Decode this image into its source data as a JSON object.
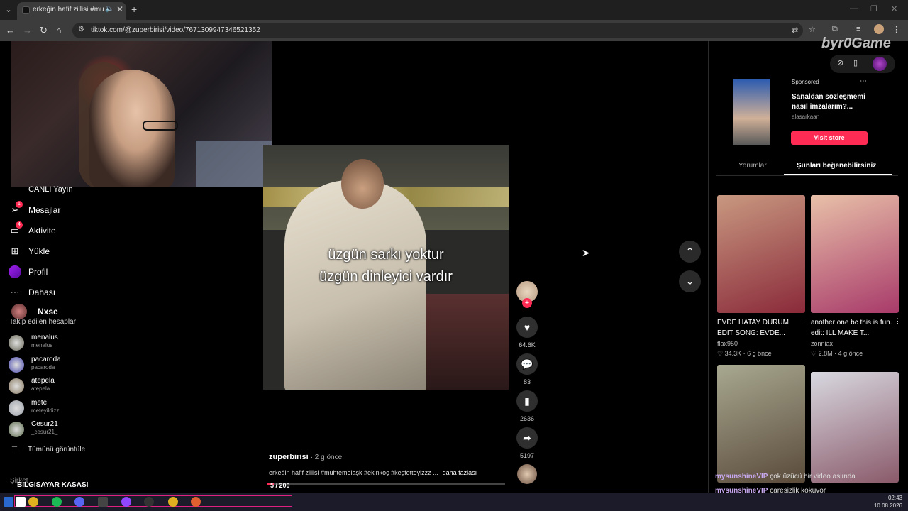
{
  "browser": {
    "tab_title": "erkeğin hafif zillisi #muhtem",
    "url": "tiktok.com/@zuperbirisi/video/7671309947346521352"
  },
  "sidebar": {
    "partial_label": "CANLI Yayın",
    "items": [
      {
        "label": "Mesajlar",
        "badge": "1"
      },
      {
        "label": "Aktivite",
        "badge": "4"
      },
      {
        "label": "Yükle"
      },
      {
        "label": "Profil"
      },
      {
        "label": "Dahası"
      }
    ],
    "current_user": "Nxse",
    "following_heading": "Takip edilen hesaplar",
    "following": [
      {
        "name": "menalus",
        "handle": "menalus",
        "color": "#6a6a5a"
      },
      {
        "name": "pacaroda",
        "handle": "pacaroda",
        "color": "#4a4ab0"
      },
      {
        "name": "atepela",
        "handle": "atepela",
        "color": "#8a7a60"
      },
      {
        "name": "mete",
        "handle": "meteyildizz",
        "color": "#9aa0a8"
      },
      {
        "name": "Cesur21",
        "handle": "_cesur21_",
        "color": "#5a6a4a"
      }
    ],
    "see_all": "Tümünü görüntüle",
    "footer_partial": "Şirket",
    "footer_overlay": "BILGISAYAR KASASI"
  },
  "video": {
    "caption_line1": "üzgün sarkı yoktur",
    "caption_line2": "üzgün dinleyici vardır",
    "author": "zuperbirisi",
    "time": "· 2 g önce",
    "description": "erkeğin hafif zillisi #muhtemelaşk #ekinkoç #keşfetteyizzz ...",
    "more": "daha fazlası",
    "progress_label": "5 / 200",
    "progress_fraction": 0.03,
    "likes": "64.6K",
    "comments": "83",
    "saves": "2636",
    "shares": "5197"
  },
  "right_panel": {
    "watermark": "byr0Game",
    "ad": {
      "sponsored": "Sponsored",
      "title": "Sanaldan sözleşmemi nasıl imzalarım?...",
      "brand": "alasarkaan",
      "cta": "Visit store"
    },
    "tabs": [
      "Yorumlar",
      "Şunları beğenebilirsiniz"
    ],
    "cards": [
      {
        "title": "EVDE HATAY DURUM EDIT SONG: EVDE...",
        "author": "flax950",
        "likes": "34.3K",
        "time": "6 g önce",
        "color1": "#c89880",
        "color2": "#8a2a3a"
      },
      {
        "title": "another one bc this is fun. edit: ILL MAKE T...",
        "author": "zonniax",
        "likes": "2.8M",
        "time": "4 g önce",
        "color1": "#e8c0a8",
        "color2": "#a83a6a"
      },
      {
        "title": "",
        "author": "",
        "likes": "",
        "time": "",
        "color1": "#a8a890",
        "color2": "#5a4a3a"
      },
      {
        "title": "",
        "author": "",
        "likes": "",
        "time": "",
        "color1": "#d8d8e0",
        "color2": "#8a5a6a"
      }
    ]
  },
  "chat": [
    {
      "user": "mysunshineVIP",
      "text": " çok üzücü bir video aslında"
    },
    {
      "user": "mysunshineVIP",
      "text": " çaresizlik kokuyor"
    }
  ],
  "clock": {
    "time": "02:43",
    "date": "10.08.2026"
  },
  "colors": {
    "accent": "#fe2c55",
    "background": "#000000"
  }
}
